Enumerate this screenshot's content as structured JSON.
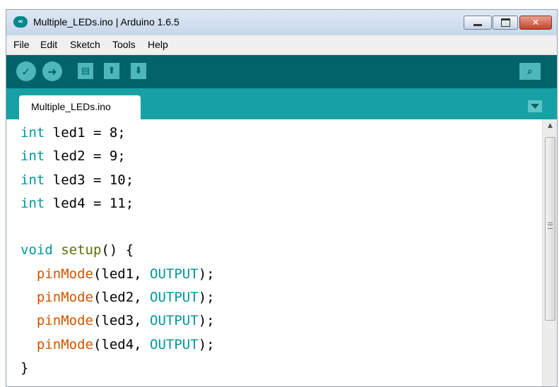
{
  "window": {
    "title": "Multiple_LEDs.ino | Arduino 1.6.5",
    "logo_glyph": "∞"
  },
  "menu": {
    "items": [
      "File",
      "Edit",
      "Sketch",
      "Tools",
      "Help"
    ]
  },
  "toolbar": {
    "buttons": [
      {
        "name": "verify",
        "icon": "checkmark-icon",
        "glyph": "✓"
      },
      {
        "name": "upload",
        "icon": "arrow-right-icon",
        "glyph": "➜"
      },
      {
        "name": "new",
        "icon": "new-file-icon",
        "glyph": "▤"
      },
      {
        "name": "open",
        "icon": "arrow-up-icon",
        "glyph": "⬆"
      },
      {
        "name": "save",
        "icon": "arrow-down-icon",
        "glyph": "⬇"
      },
      {
        "name": "serial-monitor",
        "icon": "magnifier-icon",
        "glyph": "⌕"
      }
    ]
  },
  "tabs": [
    {
      "label": "Multiple_LEDs.ino",
      "active": true
    }
  ],
  "editor": {
    "lines": [
      [
        {
          "t": "int",
          "c": "kw-type"
        },
        {
          "t": " led1 = 8;"
        }
      ],
      [
        {
          "t": "int",
          "c": "kw-type"
        },
        {
          "t": " led2 = 9;"
        }
      ],
      [
        {
          "t": "int",
          "c": "kw-type"
        },
        {
          "t": " led3 = 10;"
        }
      ],
      [
        {
          "t": "int",
          "c": "kw-type"
        },
        {
          "t": " led4 = 11;"
        }
      ],
      [],
      [
        {
          "t": "void",
          "c": "kw-void"
        },
        {
          "t": " "
        },
        {
          "t": "setup",
          "c": "fn-setup"
        },
        {
          "t": "() {"
        }
      ],
      [
        {
          "t": "  "
        },
        {
          "t": "pinMode",
          "c": "fn-pin"
        },
        {
          "t": "(led1, "
        },
        {
          "t": "OUTPUT",
          "c": "const"
        },
        {
          "t": ");"
        }
      ],
      [
        {
          "t": "  "
        },
        {
          "t": "pinMode",
          "c": "fn-pin"
        },
        {
          "t": "(led2, "
        },
        {
          "t": "OUTPUT",
          "c": "const"
        },
        {
          "t": ");"
        }
      ],
      [
        {
          "t": "  "
        },
        {
          "t": "pinMode",
          "c": "fn-pin"
        },
        {
          "t": "(led3, "
        },
        {
          "t": "OUTPUT",
          "c": "const"
        },
        {
          "t": ");"
        }
      ],
      [
        {
          "t": "  "
        },
        {
          "t": "pinMode",
          "c": "fn-pin"
        },
        {
          "t": "(led4, "
        },
        {
          "t": "OUTPUT",
          "c": "const"
        },
        {
          "t": ");"
        }
      ],
      [
        {
          "t": "}"
        }
      ]
    ]
  },
  "colors": {
    "toolbar_bg": "#006468",
    "tabstrip_bg": "#17a1a5",
    "keyword": "#00979c",
    "function": "#d35400",
    "setup": "#5e6d03"
  }
}
